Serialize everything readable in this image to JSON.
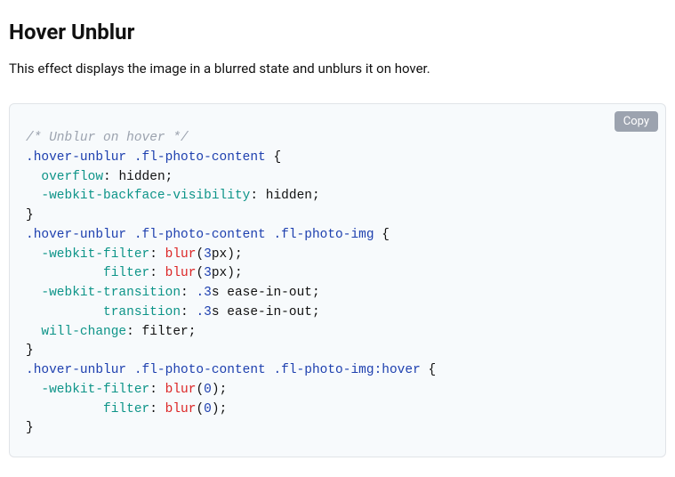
{
  "heading": "Hover Unblur",
  "description": "This effect displays the image in a blurred state and unblurs it on hover.",
  "copy_label": "Copy",
  "code": {
    "comment": "/* Unblur on hover */",
    "sel1": ".hover-unblur .fl-photo-content",
    "brace_open": " {",
    "brace_close": "}",
    "r1_prop": "overflow",
    "r1_val": "hidden",
    "r2_prop": "-webkit-backface-visibility",
    "r2_val": "hidden",
    "sel2": ".hover-unblur .fl-photo-content .fl-photo-img",
    "r3_prop": "-webkit-filter",
    "r3_func": "blur",
    "r3_num": "3",
    "r3_unit": "px",
    "r4_prop": "filter",
    "r5_prop": "-webkit-transition",
    "r5_num": ".3",
    "r5_unit": "s",
    "r5_rest": " ease-in-out",
    "r6_prop": "transition",
    "r7_prop": "will-change",
    "r7_val": "filter",
    "sel3a": ".hover-unblur .fl-photo-content .fl-photo-img",
    "sel3b": ":hover",
    "r8_num": "0",
    "colon": ": ",
    "semi": ";",
    "paren_open": "(",
    "paren_close": ")"
  }
}
